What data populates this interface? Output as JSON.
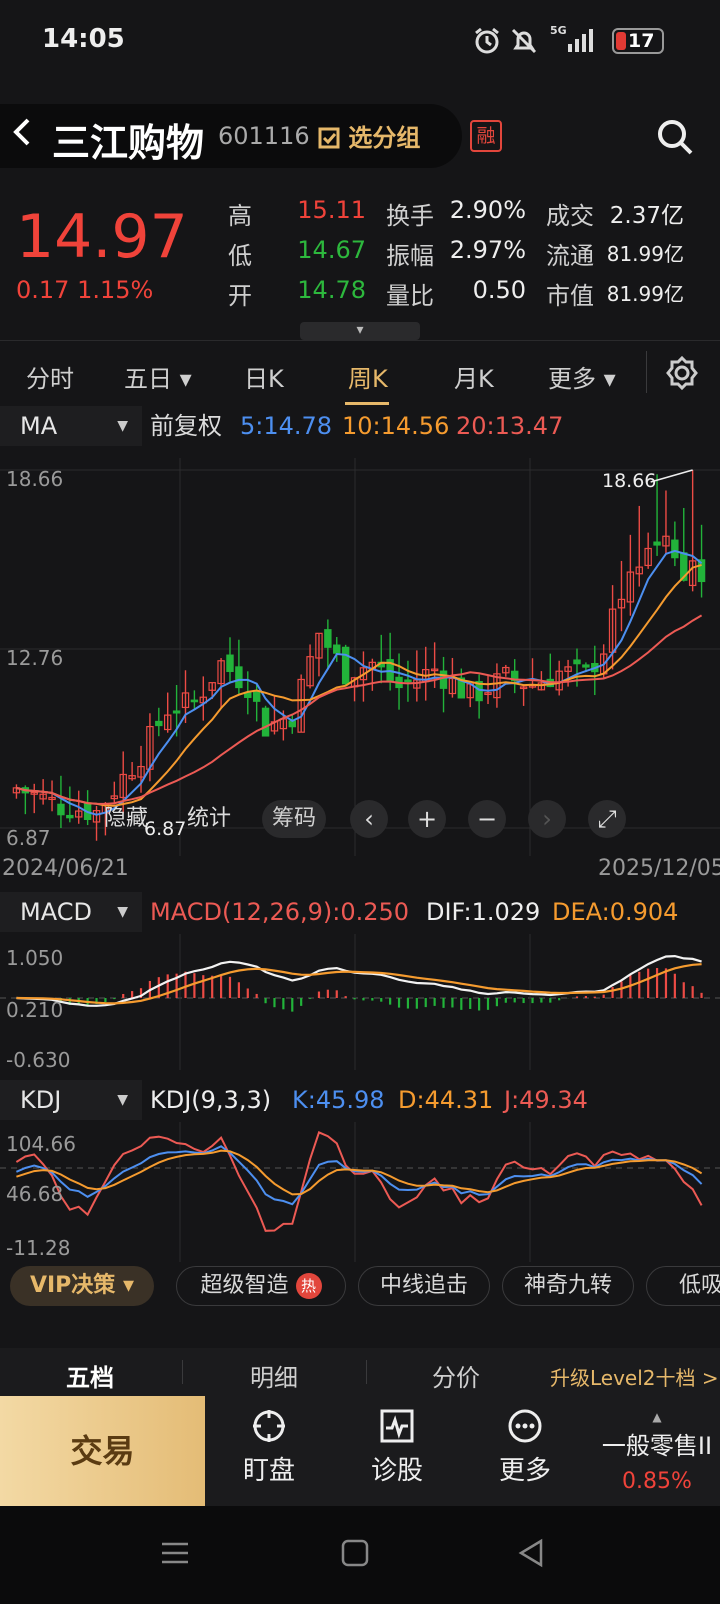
{
  "status": {
    "time": "14:05",
    "signal": "5G",
    "battery": "17"
  },
  "header": {
    "back_icon": "chevron-left-icon",
    "name": "三江购物",
    "code": "601116",
    "group_button": "选分组",
    "badge": "融"
  },
  "quote": {
    "price": "14.97",
    "change": "0.17",
    "change_pct": "1.15%",
    "rows": [
      [
        {
          "label": "高",
          "value": "15.11",
          "color": "#f0433a"
        },
        {
          "label": "换手",
          "value": "2.90%"
        },
        {
          "label": "成交",
          "value": "2.37亿"
        }
      ],
      [
        {
          "label": "低",
          "value": "14.67",
          "color": "#2db83d"
        },
        {
          "label": "振幅",
          "value": "2.97%"
        },
        {
          "label": "流通",
          "value": "81.99亿"
        }
      ],
      [
        {
          "label": "开",
          "value": "14.78",
          "color": "#2db83d"
        },
        {
          "label": "量比",
          "value": "0.50"
        },
        {
          "label": "市值",
          "value": "81.99亿"
        }
      ]
    ]
  },
  "tabs": [
    "分时",
    "五日 ▾",
    "日K",
    "周K",
    "月K",
    "更多 ▾"
  ],
  "active_tab": "周K",
  "ma": {
    "selector": "MA",
    "adjust": "前复权",
    "ma5": "5:14.78",
    "ma10": "10:14.56",
    "ma20": "20:13.47"
  },
  "kline_axis": {
    "top": "18.66",
    "mid": "12.76",
    "bottom": "6.87",
    "max_label": "18.66",
    "min_label": "6.87",
    "start_date": "2024/06/21",
    "end_date": "2025/12/05"
  },
  "tools": {
    "hide": "隐藏",
    "stats": "统计",
    "chips": "筹码"
  },
  "macd": {
    "selector": "MACD",
    "title": "MACD(12,26,9):0.250",
    "dif": "DIF:1.029",
    "dea": "DEA:0.904",
    "ax_top": "1.050",
    "ax_mid": "0.210",
    "ax_bottom": "-0.630"
  },
  "kdj": {
    "selector": "KDJ",
    "title": "KDJ(9,3,3)",
    "k": "K:45.98",
    "d": "D:44.31",
    "j": "J:49.34",
    "ax_top": "104.66",
    "ax_mid": "46.68",
    "ax_bottom": "-11.28"
  },
  "strategies": {
    "vip": "VIP决策 ▾",
    "items": [
      "超级智造",
      "中线追击",
      "神奇九转",
      "低吸能"
    ],
    "hot_badge": "热"
  },
  "detail_tabs": {
    "five": "五档",
    "detail": "明细",
    "price": "分价",
    "upgrade": "升级Level2十档 >"
  },
  "bottom": {
    "trade": "交易",
    "watch": "盯盘",
    "diagnose": "诊股",
    "more": "更多",
    "fee_label": "一般零售II",
    "fee_value": "0.85%"
  },
  "chart_data": {
    "type": "candlestick",
    "title": "",
    "ylim": [
      6.87,
      18.66
    ],
    "x_range": [
      "2024/06/21",
      "2025/12/05"
    ],
    "latest": {
      "close": 14.97,
      "high": 15.11,
      "low": 14.67,
      "open": 14.78
    },
    "ma": {
      "ma5": 14.78,
      "ma10": 14.56,
      "ma20": 13.47
    },
    "macd": {
      "dif": 1.029,
      "dea": 0.904,
      "macd": 0.25,
      "ylim": [
        -0.63,
        1.05
      ]
    },
    "kdj": {
      "k": 45.98,
      "d": 44.31,
      "j": 49.34,
      "ylim": [
        -11.28,
        104.66
      ]
    }
  }
}
